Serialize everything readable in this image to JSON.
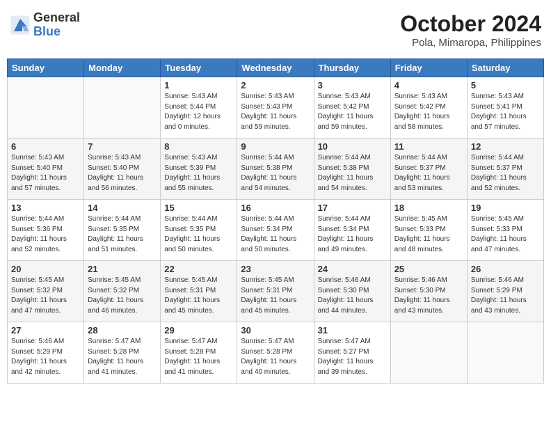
{
  "header": {
    "logo_line1": "General",
    "logo_line2": "Blue",
    "title": "October 2024",
    "subtitle": "Pola, Mimaropa, Philippines"
  },
  "weekdays": [
    "Sunday",
    "Monday",
    "Tuesday",
    "Wednesday",
    "Thursday",
    "Friday",
    "Saturday"
  ],
  "weeks": [
    [
      {
        "day": "",
        "info": ""
      },
      {
        "day": "",
        "info": ""
      },
      {
        "day": "1",
        "info": "Sunrise: 5:43 AM\nSunset: 5:44 PM\nDaylight: 12 hours\nand 0 minutes."
      },
      {
        "day": "2",
        "info": "Sunrise: 5:43 AM\nSunset: 5:43 PM\nDaylight: 11 hours\nand 59 minutes."
      },
      {
        "day": "3",
        "info": "Sunrise: 5:43 AM\nSunset: 5:42 PM\nDaylight: 11 hours\nand 59 minutes."
      },
      {
        "day": "4",
        "info": "Sunrise: 5:43 AM\nSunset: 5:42 PM\nDaylight: 11 hours\nand 58 minutes."
      },
      {
        "day": "5",
        "info": "Sunrise: 5:43 AM\nSunset: 5:41 PM\nDaylight: 11 hours\nand 57 minutes."
      }
    ],
    [
      {
        "day": "6",
        "info": "Sunrise: 5:43 AM\nSunset: 5:40 PM\nDaylight: 11 hours\nand 57 minutes."
      },
      {
        "day": "7",
        "info": "Sunrise: 5:43 AM\nSunset: 5:40 PM\nDaylight: 11 hours\nand 56 minutes."
      },
      {
        "day": "8",
        "info": "Sunrise: 5:43 AM\nSunset: 5:39 PM\nDaylight: 11 hours\nand 55 minutes."
      },
      {
        "day": "9",
        "info": "Sunrise: 5:44 AM\nSunset: 5:38 PM\nDaylight: 11 hours\nand 54 minutes."
      },
      {
        "day": "10",
        "info": "Sunrise: 5:44 AM\nSunset: 5:38 PM\nDaylight: 11 hours\nand 54 minutes."
      },
      {
        "day": "11",
        "info": "Sunrise: 5:44 AM\nSunset: 5:37 PM\nDaylight: 11 hours\nand 53 minutes."
      },
      {
        "day": "12",
        "info": "Sunrise: 5:44 AM\nSunset: 5:37 PM\nDaylight: 11 hours\nand 52 minutes."
      }
    ],
    [
      {
        "day": "13",
        "info": "Sunrise: 5:44 AM\nSunset: 5:36 PM\nDaylight: 11 hours\nand 52 minutes."
      },
      {
        "day": "14",
        "info": "Sunrise: 5:44 AM\nSunset: 5:35 PM\nDaylight: 11 hours\nand 51 minutes."
      },
      {
        "day": "15",
        "info": "Sunrise: 5:44 AM\nSunset: 5:35 PM\nDaylight: 11 hours\nand 50 minutes."
      },
      {
        "day": "16",
        "info": "Sunrise: 5:44 AM\nSunset: 5:34 PM\nDaylight: 11 hours\nand 50 minutes."
      },
      {
        "day": "17",
        "info": "Sunrise: 5:44 AM\nSunset: 5:34 PM\nDaylight: 11 hours\nand 49 minutes."
      },
      {
        "day": "18",
        "info": "Sunrise: 5:45 AM\nSunset: 5:33 PM\nDaylight: 11 hours\nand 48 minutes."
      },
      {
        "day": "19",
        "info": "Sunrise: 5:45 AM\nSunset: 5:33 PM\nDaylight: 11 hours\nand 47 minutes."
      }
    ],
    [
      {
        "day": "20",
        "info": "Sunrise: 5:45 AM\nSunset: 5:32 PM\nDaylight: 11 hours\nand 47 minutes."
      },
      {
        "day": "21",
        "info": "Sunrise: 5:45 AM\nSunset: 5:32 PM\nDaylight: 11 hours\nand 46 minutes."
      },
      {
        "day": "22",
        "info": "Sunrise: 5:45 AM\nSunset: 5:31 PM\nDaylight: 11 hours\nand 45 minutes."
      },
      {
        "day": "23",
        "info": "Sunrise: 5:45 AM\nSunset: 5:31 PM\nDaylight: 11 hours\nand 45 minutes."
      },
      {
        "day": "24",
        "info": "Sunrise: 5:46 AM\nSunset: 5:30 PM\nDaylight: 11 hours\nand 44 minutes."
      },
      {
        "day": "25",
        "info": "Sunrise: 5:46 AM\nSunset: 5:30 PM\nDaylight: 11 hours\nand 43 minutes."
      },
      {
        "day": "26",
        "info": "Sunrise: 5:46 AM\nSunset: 5:29 PM\nDaylight: 11 hours\nand 43 minutes."
      }
    ],
    [
      {
        "day": "27",
        "info": "Sunrise: 5:46 AM\nSunset: 5:29 PM\nDaylight: 11 hours\nand 42 minutes."
      },
      {
        "day": "28",
        "info": "Sunrise: 5:47 AM\nSunset: 5:28 PM\nDaylight: 11 hours\nand 41 minutes."
      },
      {
        "day": "29",
        "info": "Sunrise: 5:47 AM\nSunset: 5:28 PM\nDaylight: 11 hours\nand 41 minutes."
      },
      {
        "day": "30",
        "info": "Sunrise: 5:47 AM\nSunset: 5:28 PM\nDaylight: 11 hours\nand 40 minutes."
      },
      {
        "day": "31",
        "info": "Sunrise: 5:47 AM\nSunset: 5:27 PM\nDaylight: 11 hours\nand 39 minutes."
      },
      {
        "day": "",
        "info": ""
      },
      {
        "day": "",
        "info": ""
      }
    ]
  ]
}
